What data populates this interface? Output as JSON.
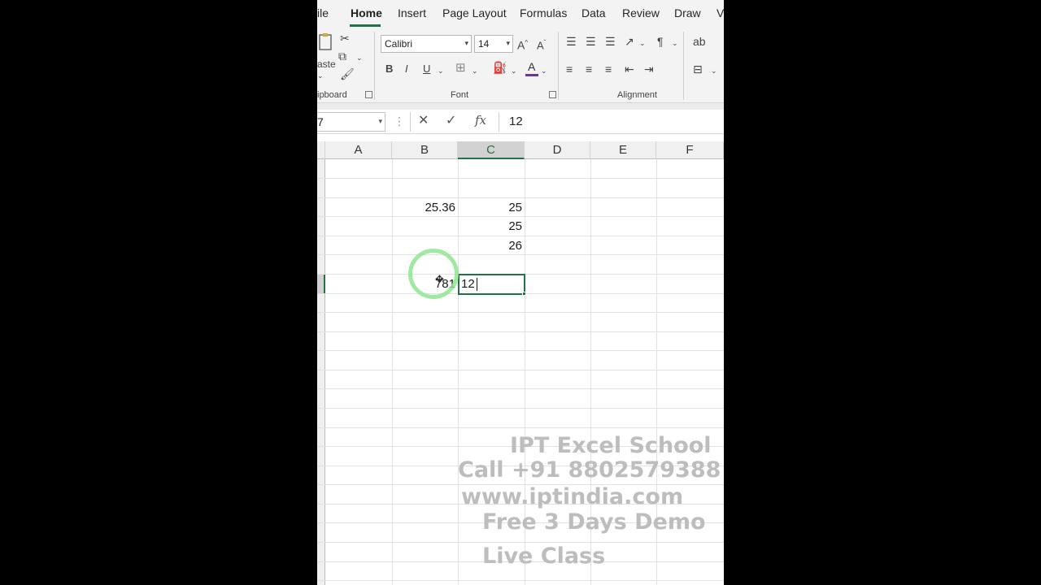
{
  "ribbon_tabs": [
    "ile",
    "Home",
    "Insert",
    "Page Layout",
    "Formulas",
    "Data",
    "Review",
    "Draw",
    "V"
  ],
  "clipboard": {
    "paste_label": "aste",
    "group_label": "ipboard"
  },
  "font": {
    "name": "Calibri",
    "size": "14",
    "group_label": "Font",
    "bold": "B",
    "italic": "I",
    "underline": "U"
  },
  "alignment": {
    "group_label": "Alignment"
  },
  "formula_bar": {
    "name_box": "7",
    "value": "12",
    "fx": "fx"
  },
  "columns": [
    "A",
    "B",
    "C",
    "D",
    "E",
    "F"
  ],
  "cells": {
    "b_row3": "25.36",
    "c_row3": "25",
    "c_row4": "25",
    "c_row5": "26",
    "b_row7": "781",
    "c_row7": "12"
  },
  "watermark": {
    "line1": "IPT Excel School",
    "line2": "Call +91 8802579388",
    "line3": "www.iptindia.com",
    "line4": "Free 3 Days Demo",
    "line5": "Live Class"
  },
  "colors": {
    "accent": "#217346",
    "font_color": "#7030a0"
  }
}
